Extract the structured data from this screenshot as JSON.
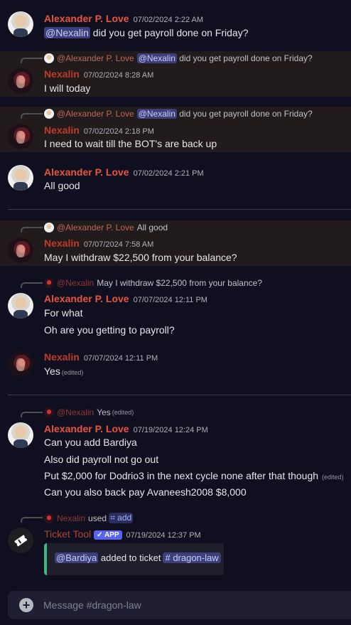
{
  "accent": {
    "alex_name": "#e8553d",
    "nex_name": "#c03a2b",
    "mention_bg": "#3d3f7a",
    "highlight_bg": "#221b1c",
    "embed_bar": "#43b581"
  },
  "messages": {
    "m1": {
      "author": "Alexander P. Love",
      "timestamp": "07/02/2024 2:22 AM",
      "mention": "@Nexalin",
      "text": " did you get payroll done on Friday?"
    },
    "m2": {
      "reply_author": "@Alexander P. Love",
      "reply_mention": "@Nexalin",
      "reply_text": " did you get payroll done on Friday?",
      "author": "Nexalin",
      "timestamp": "07/02/2024 8:28 AM",
      "text": "I will today"
    },
    "m3": {
      "reply_author": "@Alexander P. Love",
      "reply_mention": "@Nexalin",
      "reply_text": " did you get payroll done on Friday?",
      "author": "Nexalin",
      "timestamp": "07/02/2024 2:18 PM",
      "text": "I need to wait till the BOT's are back up"
    },
    "m4": {
      "author": "Alexander P. Love",
      "timestamp": "07/02/2024 2:21 PM",
      "text": "All good"
    },
    "m5": {
      "reply_author": "@Alexander P. Love",
      "reply_text": "All good",
      "author": "Nexalin",
      "timestamp": "07/07/2024 7:58 AM",
      "text": "May I withdraw $22,500 from your balance?"
    },
    "m6": {
      "reply_author": "@Nexalin",
      "reply_text": "May I withdraw $22,500 from your balance?",
      "author": "Alexander P. Love",
      "timestamp": "07/07/2024 12:11 PM",
      "line1": "For what",
      "line2": "Oh are you getting to payroll?"
    },
    "m7": {
      "author": "Nexalin",
      "timestamp": "07/07/2024 12:11 PM",
      "text": "Yes",
      "edited": "(edited)"
    },
    "m8": {
      "reply_author": "@Nexalin",
      "reply_text": "Yes",
      "reply_edited": "(edited)",
      "author": "Alexander P. Love",
      "timestamp": "07/19/2024 12:24 PM",
      "line1": "Can you add Bardiya",
      "line2": "Also did payroll not go out",
      "line3": "Put $2,000 for Dodrio3 in the next cycle none after that though",
      "line3_edited": "(edited)",
      "line4": "Can you also back pay Avaneesh2008 $8,000"
    },
    "m9": {
      "reply_author": "Nexalin",
      "reply_used": "used",
      "reply_command": "add",
      "author": "Ticket Tool",
      "badge": "APP",
      "timestamp": "07/19/2024 12:37 PM",
      "embed_mention": "@Bardiya",
      "embed_text": " added to ticket",
      "embed_channel": "dragon-law"
    }
  },
  "composer": {
    "placeholder": "Message #dragon-law"
  }
}
